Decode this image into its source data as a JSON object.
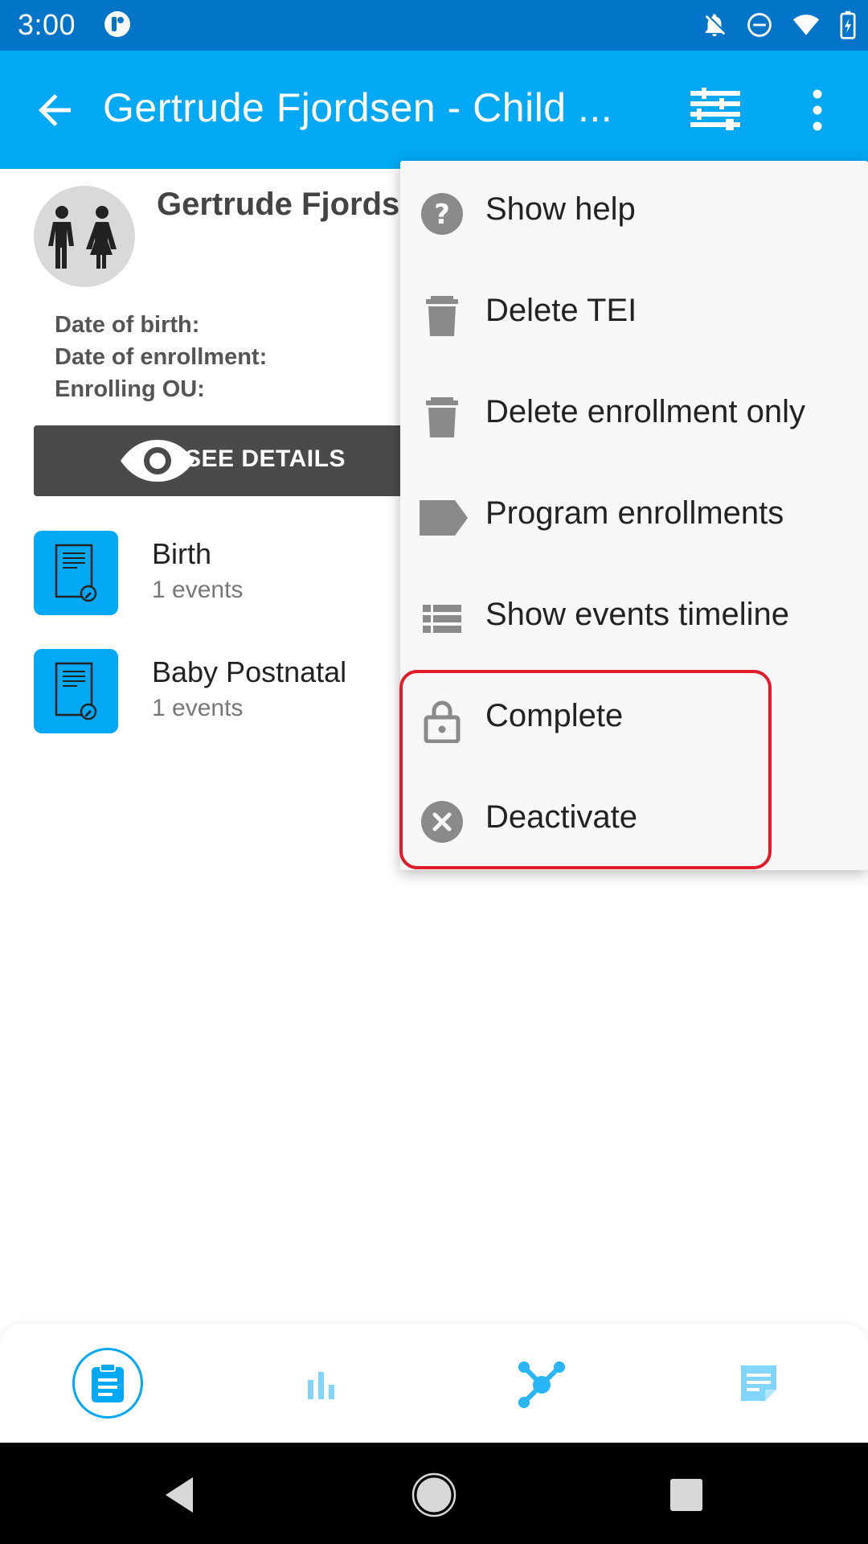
{
  "status_bar": {
    "time": "3:00",
    "icons": [
      "notifications-off-icon",
      "do-not-disturb-icon",
      "wifi-icon",
      "battery-charging-icon"
    ]
  },
  "app_bar": {
    "title": "Gertrude Fjordsen - Child ...",
    "back_icon": "arrow-back-icon",
    "filter_icon": "filter-icon",
    "more_icon": "more-vert-icon"
  },
  "tei": {
    "name": "Gertrude Fjords",
    "attributes": {
      "dob_label": "Date of birth:",
      "enrollment_label": "Date of enrollment:",
      "ou_label": "Enrolling OU:"
    },
    "see_details_label": "SEE DETAILS"
  },
  "stages": [
    {
      "name": "Birth",
      "count": "1 events"
    },
    {
      "name": "Baby Postnatal",
      "count": "1 events"
    }
  ],
  "menu": {
    "items": [
      {
        "label": "Show help",
        "icon": "help-icon"
      },
      {
        "label": "Delete TEI",
        "icon": "delete-icon"
      },
      {
        "label": "Delete enrollment only",
        "icon": "delete-icon"
      },
      {
        "label": "Program enrollments",
        "icon": "label-icon"
      },
      {
        "label": "Show events timeline",
        "icon": "list-icon"
      },
      {
        "label": "Complete",
        "icon": "lock-icon"
      },
      {
        "label": "Deactivate",
        "icon": "cancel-icon"
      }
    ]
  },
  "bottom_nav": {
    "items": [
      "tei-details-icon",
      "analytics-icon",
      "relationships-icon",
      "notes-icon"
    ]
  },
  "colors": {
    "primary": "#03a9f4",
    "primary_dark": "#0275c9",
    "highlight": "#e01c2a"
  }
}
